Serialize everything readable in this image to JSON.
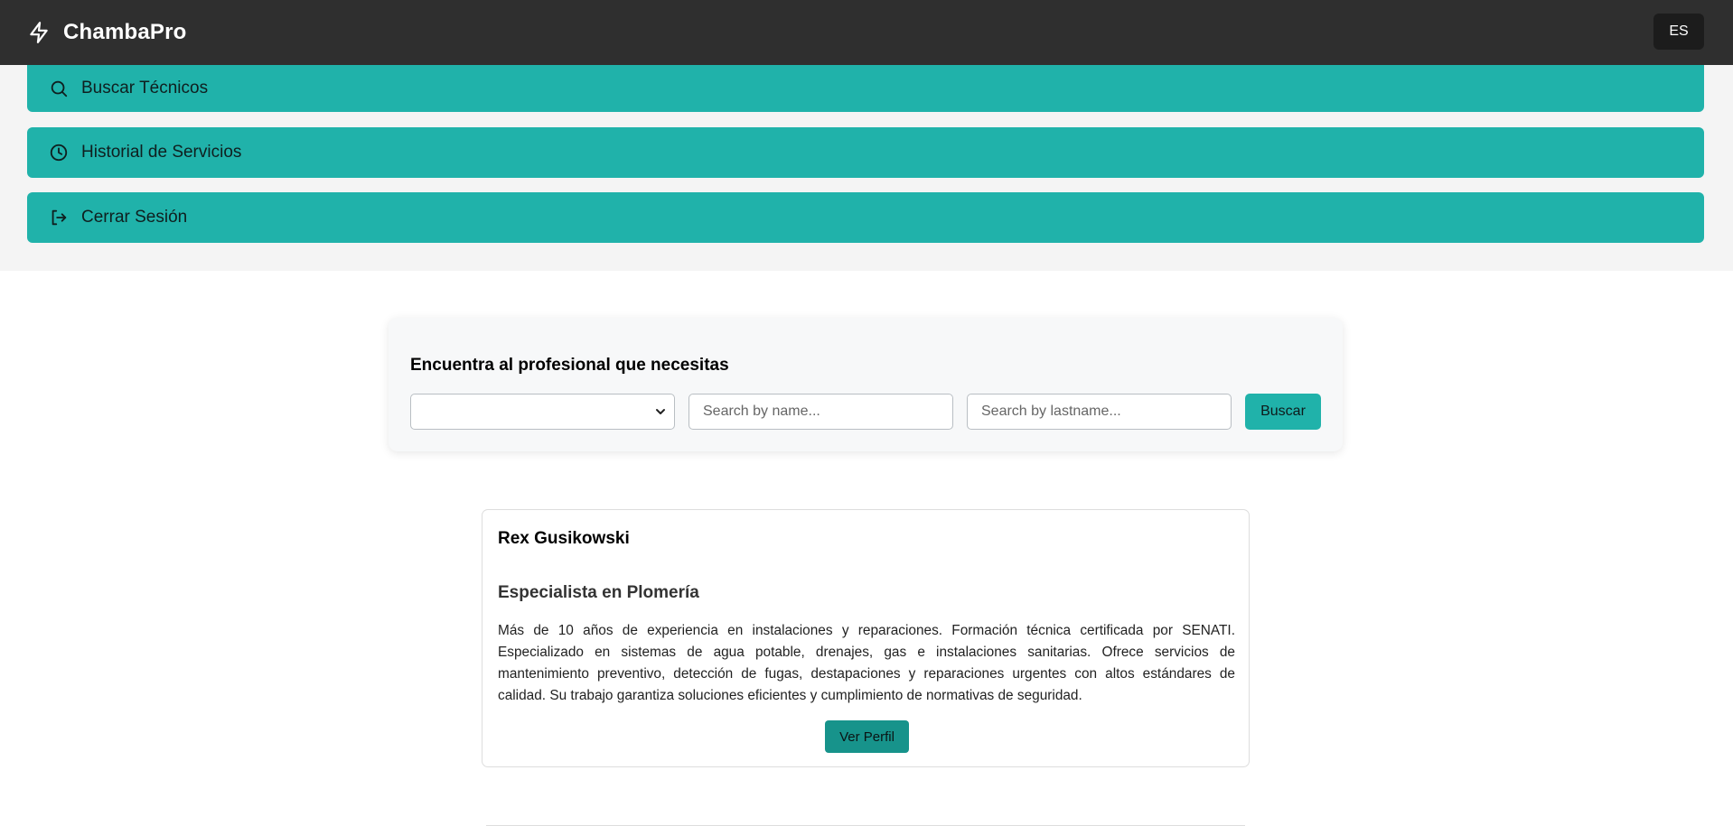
{
  "app": {
    "name": "ChambaPro",
    "language": "ES"
  },
  "menu": {
    "items": [
      {
        "label": "Buscar Técnicos",
        "icon": "search-icon"
      },
      {
        "label": "Historial de Servicios",
        "icon": "clock-icon"
      },
      {
        "label": "Cerrar Sesión",
        "icon": "logout-icon"
      }
    ]
  },
  "search": {
    "title": "Encuentra al profesional que necesitas",
    "category_value": "",
    "name_placeholder": "Search by name...",
    "lastname_placeholder": "Search by lastname...",
    "button": "Buscar"
  },
  "results": [
    {
      "name": "Rex Gusikowski",
      "specialty": "Especialista en Plomería",
      "description": "Más de 10 años de experiencia en instalaciones y reparaciones. Formación técnica certificada por SENATI. Especializado en sistemas de agua potable, drenajes, gas e instalaciones sanitarias. Ofrece servicios de mantenimiento preventivo, detección de fugas, destapaciones y reparaciones urgentes con altos estándares de calidad. Su trabajo garantiza soluciones eficientes y cumplimiento de normativas de seguridad.",
      "button": "Ver Perfil"
    }
  ],
  "colors": {
    "topbar": "#2f2f2f",
    "accent": "#20b2aa",
    "accent_dark": "#17938b",
    "menu_background": "#f4f4f4"
  }
}
